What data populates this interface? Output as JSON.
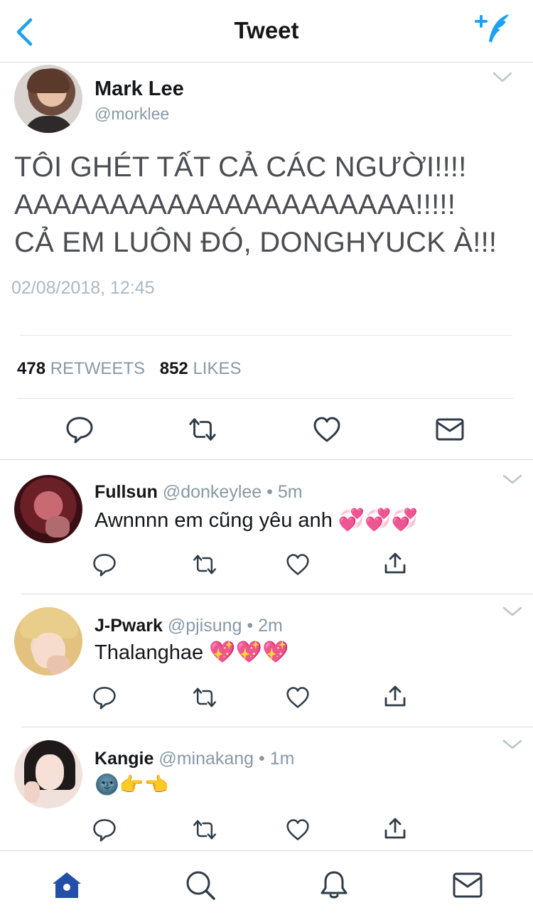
{
  "colors": {
    "accent": "#1da1f2",
    "text": "#14171a",
    "muted": "#8899a6",
    "tab_active": "#244fa8"
  },
  "header": {
    "title": "Tweet",
    "back_icon": "chevron-left-icon",
    "compose_icon": "compose-tweet-icon"
  },
  "main_tweet": {
    "name": "Mark Lee",
    "handle": "@morklee",
    "lines": [
      "TÔI GHÉT TẤT CẢ CÁC NGƯỜI!!!!",
      "AAAAAAAAAAAAAAAAAAAAA!!!!!",
      "CẢ EM LUÔN ĐÓ, DONGHYUCK À!!!"
    ],
    "date": "02/08/2018, 12:45",
    "retweets_count": "478",
    "retweets_label": "RETWEETS",
    "likes_count": "852",
    "likes_label": "LIKES",
    "actions": [
      "reply-icon",
      "retweet-icon",
      "like-icon",
      "message-icon"
    ]
  },
  "replies": [
    {
      "name": "Fullsun",
      "handle": "@donkeylee",
      "dot": "•",
      "time": "5m",
      "text": "Awnnnn em cũng yêu anh",
      "emoji": "💞💞💞"
    },
    {
      "name": "J-Pwark",
      "handle": "@pjisung",
      "dot": "•",
      "time": "2m",
      "text": "Thalanghae",
      "emoji": "💖💖💖"
    },
    {
      "name": "Kangie",
      "handle": "@minakang",
      "dot": "•",
      "time": "1m",
      "text": "",
      "emoji": "🌚👉👈"
    }
  ],
  "tabbar": {
    "tabs": [
      "home-icon",
      "search-icon",
      "notifications-icon",
      "messages-icon"
    ],
    "active": "home-icon"
  }
}
